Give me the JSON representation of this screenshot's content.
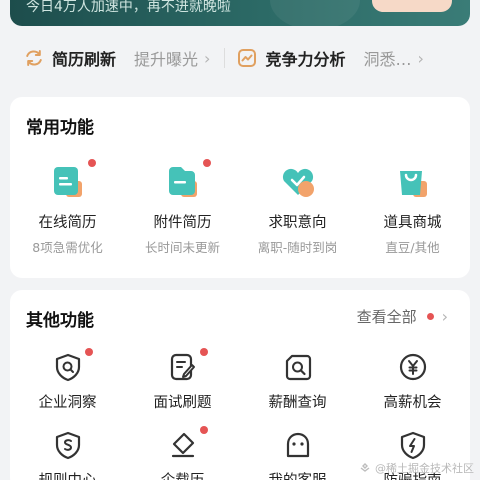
{
  "banner": {
    "text": "今日4万人加速中，再不进就晚啦"
  },
  "quick_row": [
    {
      "title": "简历刷新",
      "sub": "提升曝光",
      "icon": "refresh-icon"
    },
    {
      "title": "竞争力分析",
      "sub": "洞悉…",
      "icon": "chart-icon"
    }
  ],
  "common": {
    "title": "常用功能",
    "items": [
      {
        "label": "在线简历",
        "sub": "8项急需优化",
        "icon": "online-resume-icon",
        "badge": true
      },
      {
        "label": "附件简历",
        "sub": "长时间未更新",
        "icon": "attachment-resume-icon",
        "badge": true
      },
      {
        "label": "求职意向",
        "sub": "离职-随时到岗",
        "icon": "job-intent-icon",
        "badge": false
      },
      {
        "label": "道具商城",
        "sub": "直豆/其他",
        "icon": "shop-icon",
        "badge": false
      }
    ]
  },
  "other": {
    "title": "其他功能",
    "see_all": "查看全部",
    "row1": [
      {
        "label": "企业洞察",
        "icon": "company-insight-icon",
        "badge": true
      },
      {
        "label": "面试刷题",
        "icon": "interview-practice-icon",
        "badge": true
      },
      {
        "label": "薪酬查询",
        "icon": "salary-query-icon",
        "badge": false
      },
      {
        "label": "高薪机会",
        "icon": "high-salary-icon",
        "badge": false
      }
    ],
    "row2": [
      {
        "label": "规则中心",
        "icon": "rules-center-icon",
        "badge": false
      },
      {
        "label": "企载历",
        "icon": "company-history-icon",
        "badge": true
      },
      {
        "label": "我的客服",
        "icon": "customer-service-icon",
        "badge": false
      },
      {
        "label": "防骗指南",
        "icon": "anti-fraud-icon",
        "badge": false
      }
    ]
  },
  "watermark": "@稀土掘金技术社区",
  "colors": {
    "accent_teal": "#3cbcb3",
    "accent_orange": "#f2a36b",
    "badge_red": "#e55454"
  }
}
